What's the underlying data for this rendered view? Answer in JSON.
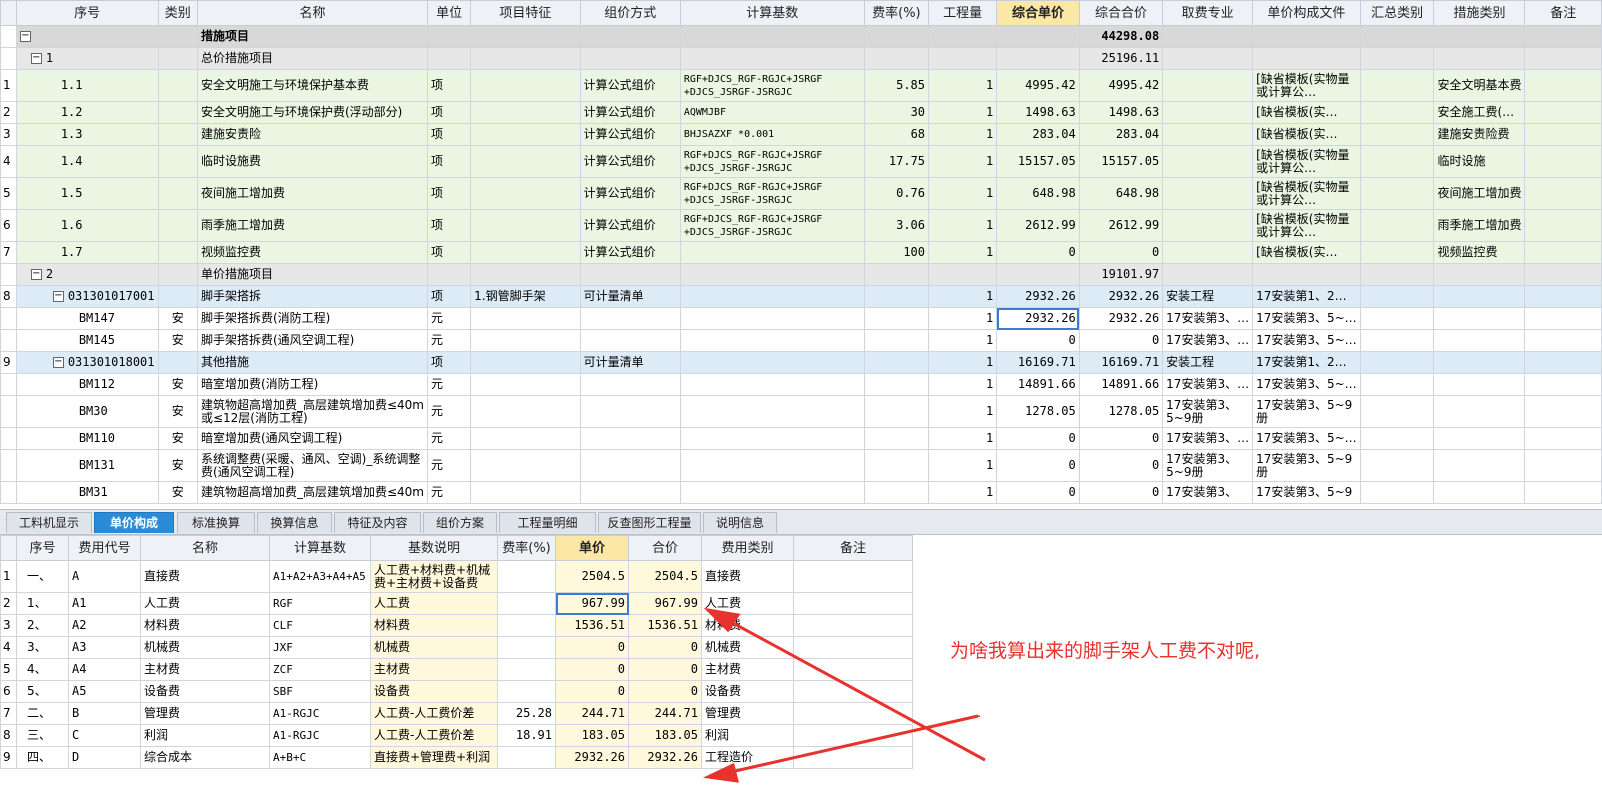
{
  "top_columns": [
    "序号",
    "类别",
    "名称",
    "单位",
    "项目特征",
    "组价方式",
    "计算基数",
    "费率(%)",
    "工程量",
    "综合单价",
    "综合合价",
    "取费专业",
    "单价构成文件",
    "汇总类别",
    "措施类别",
    "备注"
  ],
  "top_rows": [
    {
      "kind": "hdr",
      "num": "",
      "code": "",
      "box": "−",
      "cat": "",
      "name": "措施项目",
      "unit": "",
      "feat": "",
      "method": "",
      "base": "",
      "rate": "",
      "qty": "",
      "price": "",
      "total": "44298.08",
      "major": "",
      "file": "",
      "sum": "",
      "mtype": "",
      "note": ""
    },
    {
      "kind": "sub",
      "num": "",
      "code": "1",
      "box": "−",
      "cat": "",
      "name": "总价措施项目",
      "unit": "",
      "feat": "",
      "method": "",
      "base": "",
      "rate": "",
      "qty": "",
      "price": "",
      "total": "25196.11",
      "major": "",
      "file": "",
      "sum": "",
      "mtype": "",
      "note": ""
    },
    {
      "kind": "item",
      "num": "1",
      "code": "1.1",
      "cat": "",
      "name": "安全文明施工与环境保护基本费",
      "unit": "项",
      "feat": "",
      "method": "计算公式组价",
      "base": "RGF+DJCS_RGF-RGJC+JSRGF +DJCS_JSRGF-JSRGJC",
      "rate": "5.85",
      "qty": "1",
      "price": "4995.42",
      "total": "4995.42",
      "major": "",
      "file": "[缺省模板(实物量或计算公…",
      "sum": "",
      "mtype": "安全文明基本费",
      "note": ""
    },
    {
      "kind": "item",
      "num": "2",
      "code": "1.2",
      "cat": "",
      "name": "安全文明施工与环境保护费(浮动部分)",
      "unit": "项",
      "feat": "",
      "method": "计算公式组价",
      "base": "AQWMJBF",
      "rate": "30",
      "qty": "1",
      "price": "1498.63",
      "total": "1498.63",
      "major": "",
      "file": "[缺省模板(实…",
      "sum": "",
      "mtype": "安全施工费(…",
      "note": ""
    },
    {
      "kind": "item",
      "num": "3",
      "code": "1.3",
      "cat": "",
      "name": "建施安责险",
      "unit": "项",
      "feat": "",
      "method": "计算公式组价",
      "base": "BHJSAZXF *0.001",
      "rate": "68",
      "qty": "1",
      "price": "283.04",
      "total": "283.04",
      "major": "",
      "file": "[缺省模板(实…",
      "sum": "",
      "mtype": "建施安责险费",
      "note": ""
    },
    {
      "kind": "item",
      "num": "4",
      "code": "1.4",
      "cat": "",
      "name": "临时设施费",
      "unit": "项",
      "feat": "",
      "method": "计算公式组价",
      "base": "RGF+DJCS_RGF-RGJC+JSRGF +DJCS_JSRGF-JSRGJC",
      "rate": "17.75",
      "qty": "1",
      "price": "15157.05",
      "total": "15157.05",
      "major": "",
      "file": "[缺省模板(实物量或计算公…",
      "sum": "",
      "mtype": "临时设施",
      "note": ""
    },
    {
      "kind": "item",
      "num": "5",
      "code": "1.5",
      "cat": "",
      "name": "夜间施工增加费",
      "unit": "项",
      "feat": "",
      "method": "计算公式组价",
      "base": "RGF+DJCS_RGF-RGJC+JSRGF +DJCS_JSRGF-JSRGJC",
      "rate": "0.76",
      "qty": "1",
      "price": "648.98",
      "total": "648.98",
      "major": "",
      "file": "[缺省模板(实物量或计算公…",
      "sum": "",
      "mtype": "夜间施工增加费",
      "note": ""
    },
    {
      "kind": "item",
      "num": "6",
      "code": "1.6",
      "cat": "",
      "name": "雨季施工增加费",
      "unit": "项",
      "feat": "",
      "method": "计算公式组价",
      "base": "RGF+DJCS_RGF-RGJC+JSRGF +DJCS_JSRGF-JSRGJC",
      "rate": "3.06",
      "qty": "1",
      "price": "2612.99",
      "total": "2612.99",
      "major": "",
      "file": "[缺省模板(实物量或计算公…",
      "sum": "",
      "mtype": "雨季施工增加费",
      "note": ""
    },
    {
      "kind": "item",
      "num": "7",
      "code": "1.7",
      "cat": "",
      "name": "视频监控费",
      "unit": "项",
      "feat": "",
      "method": "计算公式组价",
      "base": "",
      "rate": "100",
      "qty": "1",
      "price": "0",
      "total": "0",
      "major": "",
      "file": "[缺省模板(实…",
      "sum": "",
      "mtype": "视频监控费",
      "note": ""
    },
    {
      "kind": "sub",
      "num": "",
      "code": "2",
      "box": "−",
      "cat": "",
      "name": "单价措施项目",
      "unit": "",
      "feat": "",
      "method": "",
      "base": "",
      "rate": "",
      "qty": "",
      "price": "",
      "total": "19101.97",
      "major": "",
      "file": "",
      "sum": "",
      "mtype": "",
      "note": ""
    },
    {
      "kind": "qd",
      "num": "8",
      "code": "031301017001",
      "box": "−",
      "cat": "",
      "name": "脚手架搭拆",
      "unit": "项",
      "feat": "1.钢管脚手架",
      "method": "可计量清单",
      "base": "",
      "rate": "",
      "qty": "1",
      "price": "2932.26",
      "total": "2932.26",
      "major": "安装工程",
      "file": "17安装第1、2…",
      "sum": "",
      "mtype": "",
      "note": ""
    },
    {
      "kind": "de",
      "num": "",
      "code": "BM147",
      "cat": "安",
      "name": "脚手架搭拆费(消防工程)",
      "unit": "元",
      "feat": "",
      "method": "",
      "base": "",
      "rate": "",
      "qty": "1",
      "price": "2932.26",
      "total": "2932.26",
      "major": "17安装第3、…",
      "file": "17安装第3、5~…",
      "sum": "",
      "mtype": "",
      "note": "",
      "cur": true
    },
    {
      "kind": "de",
      "num": "",
      "code": "BM145",
      "cat": "安",
      "name": "脚手架搭拆费(通风空调工程)",
      "unit": "元",
      "feat": "",
      "method": "",
      "base": "",
      "rate": "",
      "qty": "1",
      "price": "0",
      "total": "0",
      "major": "17安装第3、…",
      "file": "17安装第3、5~…",
      "sum": "",
      "mtype": "",
      "note": ""
    },
    {
      "kind": "qd",
      "num": "9",
      "code": "031301018001",
      "box": "−",
      "cat": "",
      "name": "其他措施",
      "unit": "项",
      "feat": "",
      "method": "可计量清单",
      "base": "",
      "rate": "",
      "qty": "1",
      "price": "16169.71",
      "total": "16169.71",
      "major": "安装工程",
      "file": "17安装第1、2…",
      "sum": "",
      "mtype": "",
      "note": ""
    },
    {
      "kind": "de",
      "num": "",
      "code": "BM112",
      "cat": "安",
      "name": "暗室增加费(消防工程)",
      "unit": "元",
      "feat": "",
      "method": "",
      "base": "",
      "rate": "",
      "qty": "1",
      "price": "14891.66",
      "total": "14891.66",
      "major": "17安装第3、…",
      "file": "17安装第3、5~…",
      "sum": "",
      "mtype": "",
      "note": ""
    },
    {
      "kind": "de",
      "num": "",
      "code": "BM30",
      "cat": "安",
      "name": "建筑物超高增加费_高层建筑增加费≤40m或≤12层(消防工程)",
      "unit": "元",
      "feat": "",
      "method": "",
      "base": "",
      "rate": "",
      "qty": "1",
      "price": "1278.05",
      "total": "1278.05",
      "major": "17安装第3、5~9册",
      "file": "17安装第3、5~9册",
      "sum": "",
      "mtype": "",
      "note": ""
    },
    {
      "kind": "de",
      "num": "",
      "code": "BM110",
      "cat": "安",
      "name": "暗室增加费(通风空调工程)",
      "unit": "元",
      "feat": "",
      "method": "",
      "base": "",
      "rate": "",
      "qty": "1",
      "price": "0",
      "total": "0",
      "major": "17安装第3、…",
      "file": "17安装第3、5~…",
      "sum": "",
      "mtype": "",
      "note": ""
    },
    {
      "kind": "de",
      "num": "",
      "code": "BM131",
      "cat": "安",
      "name": "系统调整费(采暖、通风、空调)_系统调整费(通风空调工程)",
      "unit": "元",
      "feat": "",
      "method": "",
      "base": "",
      "rate": "",
      "qty": "1",
      "price": "0",
      "total": "0",
      "major": "17安装第3、5~9册",
      "file": "17安装第3、5~9册",
      "sum": "",
      "mtype": "",
      "note": ""
    },
    {
      "kind": "de",
      "num": "",
      "code": "BM31",
      "cat": "安",
      "name": "建筑物超高增加费_高层建筑增加费≤40m",
      "unit": "元",
      "feat": "",
      "method": "",
      "base": "",
      "rate": "",
      "qty": "1",
      "price": "0",
      "total": "0",
      "major": "17安装第3、",
      "file": "17安装第3、5~9",
      "sum": "",
      "mtype": "",
      "note": ""
    }
  ],
  "tabs": [
    {
      "label": "工料机显示",
      "active": false
    },
    {
      "label": "单价构成",
      "active": true
    },
    {
      "label": "标准换算",
      "active": false
    },
    {
      "label": "换算信息",
      "active": false
    },
    {
      "label": "特征及内容",
      "active": false
    },
    {
      "label": "组价方案",
      "active": false
    },
    {
      "label": "工程量明细",
      "active": false
    },
    {
      "label": "反查图形工程量",
      "active": false
    },
    {
      "label": "说明信息",
      "active": false
    }
  ],
  "bottom_columns": [
    "序号",
    "费用代号",
    "名称",
    "计算基数",
    "基数说明",
    "费率(%)",
    "单价",
    "合价",
    "费用类别",
    "备注"
  ],
  "bottom_rows": [
    {
      "idx": "1",
      "seq": "一、",
      "code": "A",
      "name": "直接费",
      "base": "A1+A2+A3+A4+A5",
      "desc": "人工费+材料费+机械费+主材费+设备费",
      "rate": "",
      "price": "2504.5",
      "total": "2504.5",
      "type": "直接费",
      "note": ""
    },
    {
      "idx": "2",
      "seq": "1、",
      "code": "A1",
      "name": "人工费",
      "base": "RGF",
      "desc": "人工费",
      "rate": "",
      "price": "967.99",
      "total": "967.99",
      "type": "人工费",
      "note": "",
      "cur": true
    },
    {
      "idx": "3",
      "seq": "2、",
      "code": "A2",
      "name": "材料费",
      "base": "CLF",
      "desc": "材料费",
      "rate": "",
      "price": "1536.51",
      "total": "1536.51",
      "type": "材料费",
      "note": ""
    },
    {
      "idx": "4",
      "seq": "3、",
      "code": "A3",
      "name": "机械费",
      "base": "JXF",
      "desc": "机械费",
      "rate": "",
      "price": "0",
      "total": "0",
      "type": "机械费",
      "note": ""
    },
    {
      "idx": "5",
      "seq": "4、",
      "code": "A4",
      "name": "主材费",
      "base": "ZCF",
      "desc": "主材费",
      "rate": "",
      "price": "0",
      "total": "0",
      "type": "主材费",
      "note": ""
    },
    {
      "idx": "6",
      "seq": "5、",
      "code": "A5",
      "name": "设备费",
      "base": "SBF",
      "desc": "设备费",
      "rate": "",
      "price": "0",
      "total": "0",
      "type": "设备费",
      "note": ""
    },
    {
      "idx": "7",
      "seq": "二、",
      "code": "B",
      "name": "管理费",
      "base": "A1-RGJC",
      "desc": "人工费-人工费价差",
      "rate": "25.28",
      "price": "244.71",
      "total": "244.71",
      "type": "管理费",
      "note": ""
    },
    {
      "idx": "8",
      "seq": "三、",
      "code": "C",
      "name": "利润",
      "base": "A1-RGJC",
      "desc": "人工费-人工费价差",
      "rate": "18.91",
      "price": "183.05",
      "total": "183.05",
      "type": "利润",
      "note": ""
    },
    {
      "idx": "9",
      "seq": "四、",
      "code": "D",
      "name": "综合成本",
      "base": "A+B+C",
      "desc": "直接费+管理费+利润",
      "rate": "",
      "price": "2932.26",
      "total": "2932.26",
      "type": "工程造价",
      "note": ""
    }
  ],
  "annotation": "为啥我算出来的脚手架人工费不对呢,",
  "colors": {
    "annotation": "#e8322e",
    "active_tab": "#2a8bd9",
    "selected_header": "#fbe7a6",
    "item_row": "#eaf6e2",
    "list_row": "#ddebf7"
  }
}
